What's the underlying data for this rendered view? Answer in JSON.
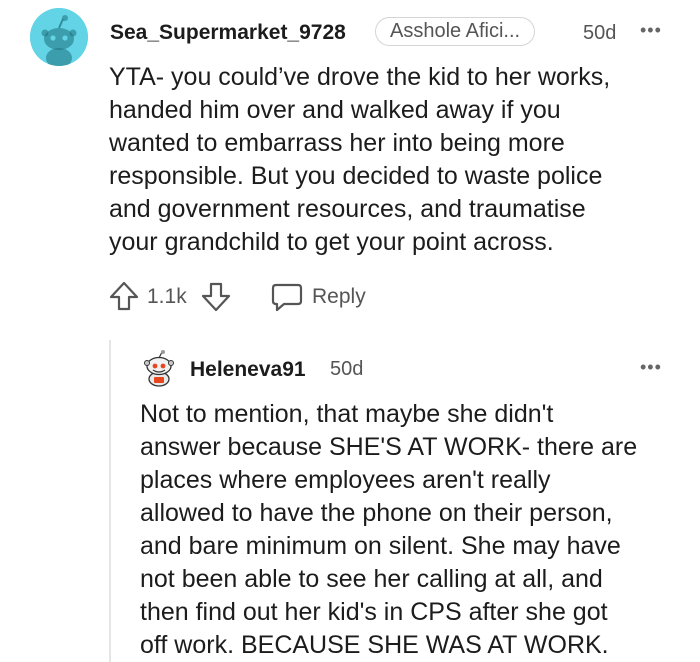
{
  "comment": {
    "username": "Sea_Supermarket_9728",
    "flair": "Asshole Afici...",
    "age": "50d",
    "more_label": "•••",
    "body_lines": [
      "YTA- you could’ve drove the kid to her works,",
      "handed him over and walked away if you",
      "wanted to embarrass her into being more",
      "responsible. But you decided to waste police",
      "and government resources, and traumatise",
      "your grandchild to get your point across."
    ],
    "score": "1.1k",
    "reply_label": "Reply"
  },
  "reply": {
    "username": "Heleneva91",
    "age": "50d",
    "more_label": "•••",
    "body_lines": [
      "Not to mention, that maybe she didn't",
      "answer because SHE'S AT WORK- there are",
      "places where employees aren't really",
      "allowed to have the phone on their person,",
      "and bare minimum on silent. She may have",
      "not been able to see her calling at all, and",
      "then find out her kid's in CPS after she got",
      "off work. BECAUSE SHE WAS AT WORK."
    ]
  },
  "colors": {
    "avatar_bg": "#62d4e6",
    "text": "#1c1c1c",
    "muted": "#555555"
  }
}
